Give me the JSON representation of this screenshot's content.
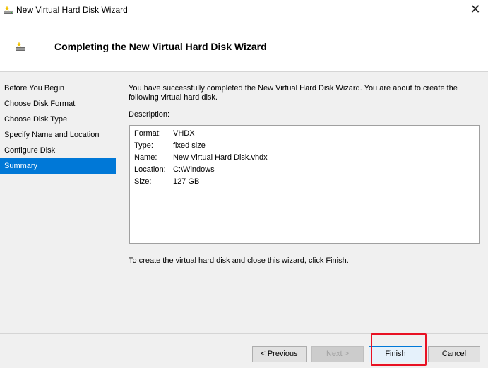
{
  "window": {
    "title": "New Virtual Hard Disk Wizard",
    "close_glyph": "✕",
    "icon": "virtual-disk-icon"
  },
  "header": {
    "title": "Completing the New Virtual Hard Disk Wizard",
    "icon": "virtual-disk-icon"
  },
  "steps": [
    {
      "label": "Before You Begin",
      "active": false
    },
    {
      "label": "Choose Disk Format",
      "active": false
    },
    {
      "label": "Choose Disk Type",
      "active": false
    },
    {
      "label": "Specify Name and Location",
      "active": false
    },
    {
      "label": "Configure Disk",
      "active": false
    },
    {
      "label": "Summary",
      "active": true
    }
  ],
  "main": {
    "intro": "You have successfully completed the New Virtual Hard Disk Wizard. You are about to create the following virtual hard disk.",
    "description_label": "Description:",
    "description": [
      {
        "key": "Format:",
        "value": "VHDX"
      },
      {
        "key": "Type:",
        "value": "fixed size"
      },
      {
        "key": "Name:",
        "value": "New Virtual Hard Disk.vhdx"
      },
      {
        "key": "Location:",
        "value": "C:\\Windows"
      },
      {
        "key": "Size:",
        "value": "127 GB"
      }
    ],
    "finish_note": "To create the virtual hard disk and close this wizard, click Finish."
  },
  "buttons": {
    "previous": "< Previous",
    "next": "Next >",
    "finish": "Finish",
    "cancel": "Cancel"
  },
  "colors": {
    "accent": "#0078d7",
    "highlight": "#e81123"
  }
}
